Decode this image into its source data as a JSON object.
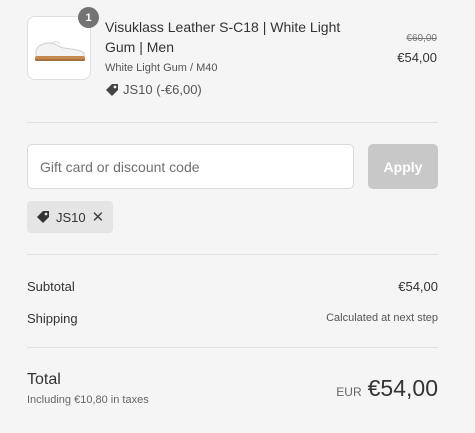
{
  "product": {
    "quantity": "1",
    "name": "Visuklass Leather S-C18 | White Light Gum | Men",
    "variant": "White Light Gum / M40",
    "discount_tag": "JS10 (-€6,00)",
    "original_price": "€60,00",
    "price": "€54,00",
    "thumbnail_icon": "sneaker-image"
  },
  "discount_form": {
    "placeholder": "Gift card or discount code",
    "value": "",
    "apply_label": "Apply",
    "applied_code": "JS10",
    "remove_icon": "close-icon"
  },
  "summary": {
    "subtotal_label": "Subtotal",
    "subtotal_value": "€54,00",
    "shipping_label": "Shipping",
    "shipping_value": "Calculated at next step",
    "total_label": "Total",
    "tax_note": "Including €10,80 in taxes",
    "currency": "EUR",
    "total_value": "€54,00"
  },
  "colors": {
    "background": "#f5f5f5",
    "apply_disabled": "#c8c8c8",
    "chip_bg": "#e5e5e5",
    "badge": "#737373"
  }
}
